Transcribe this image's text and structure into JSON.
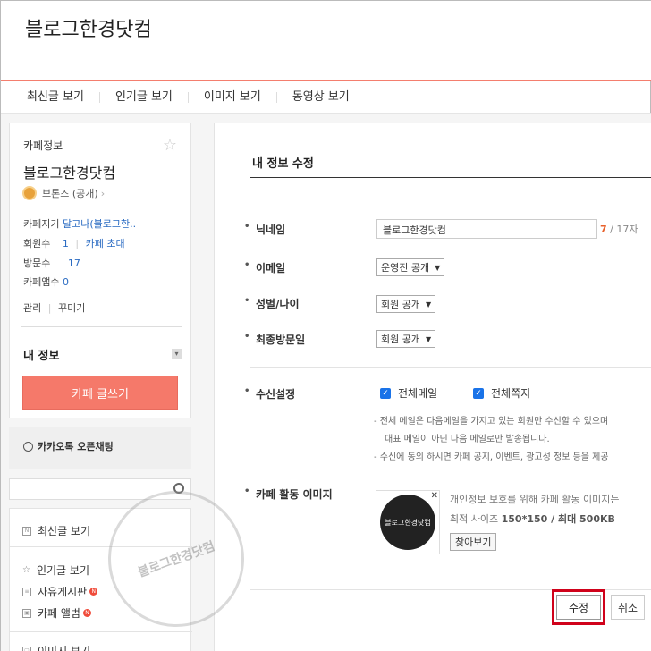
{
  "header": {
    "title": "블로그한경닷컴"
  },
  "nav": {
    "items": [
      "최신글 보기",
      "인기글 보기",
      "이미지 보기",
      "동영상 보기"
    ]
  },
  "sidebar": {
    "title": "카페정보",
    "cafe_name": "블로그한경닷컴",
    "level": "브론즈 (공개)",
    "manager_label": "카페지기",
    "manager_value": "달고나(블로그한..",
    "members_label": "회원수",
    "members_value": "1",
    "invite": "카페 초대",
    "visits_label": "방문수",
    "visits_value": "17",
    "app_label": "카페앱수",
    "app_value": "0",
    "manage": "관리",
    "decorate": "꾸미기",
    "my_info": "내 정보",
    "write_button": "카페 글쓰기",
    "chat": "카카오톡 오픈채팅",
    "menu": [
      "최신글 보기",
      "인기글 보기",
      "자유게시판",
      "카페 앨범",
      "이미지 보기"
    ]
  },
  "form": {
    "title": "내 정보 수정",
    "nickname_label": "닉네임",
    "nickname_value": "블로그한경닷컴",
    "counter_current": "7",
    "counter_total": "/ 17자",
    "email_label": "이메일",
    "email_value": "운영진 공개",
    "gender_label": "성별/나이",
    "gender_value": "회원 공개",
    "lastvisit_label": "최종방문일",
    "lastvisit_value": "회원 공개",
    "receive_label": "수신설정",
    "receive_mail": "전체메일",
    "receive_note": "전체쪽지",
    "note1": "- 전체 메일은 다음메일을 가지고 있는 회원만 수신할 수 있으며",
    "note2": "대표 메일이 아닌 다음 메일로만 발송됩니다.",
    "note3": "- 수신에 동의 하시면 카페 공지, 이벤트, 광고성 정보 등을 제공",
    "image_label": "카페 활동 이미지",
    "image_desc": "개인정보 보호를 위해 카페 활동 이미지는",
    "image_size_prefix": "최적 사이즈",
    "image_size_value": "150*150 / 최대 500KB",
    "browse": "찾아보기",
    "thumb_text": "블로그한경닷컴",
    "submit": "수정",
    "cancel": "취소"
  },
  "watermark": "블로그한경닷컴"
}
